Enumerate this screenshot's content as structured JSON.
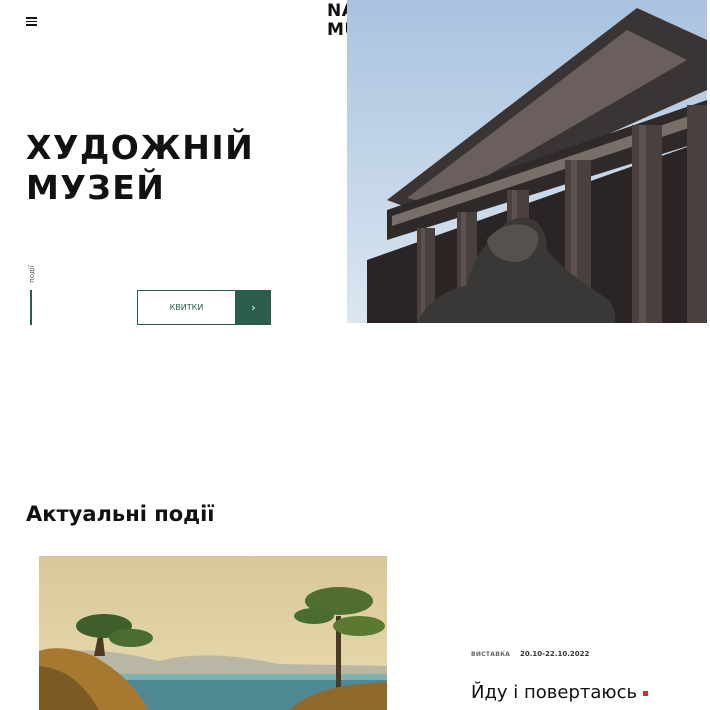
{
  "header": {
    "menu_icon": "hamburger-menu-icon",
    "logo_line1": "NA",
    "logo_line2": "MU"
  },
  "hero": {
    "title_line1": "ХУДОЖНІЙ",
    "title_line2": "МУЗЕЙ",
    "vertical_label": "події",
    "tickets_label": "КВИТКИ",
    "tickets_arrow": "›",
    "accent_color": "#2b5d4d",
    "photo": "museum-building-with-lion-statue"
  },
  "events": {
    "section_title": "Актуальні події",
    "items": [
      {
        "type": "ВИСТАВКА",
        "dates": "20.10-22.10.2022",
        "title": "Йду і повертаюсь",
        "marker_color": "#c0392b",
        "image": "landscape-painting-sea-pines"
      }
    ]
  }
}
